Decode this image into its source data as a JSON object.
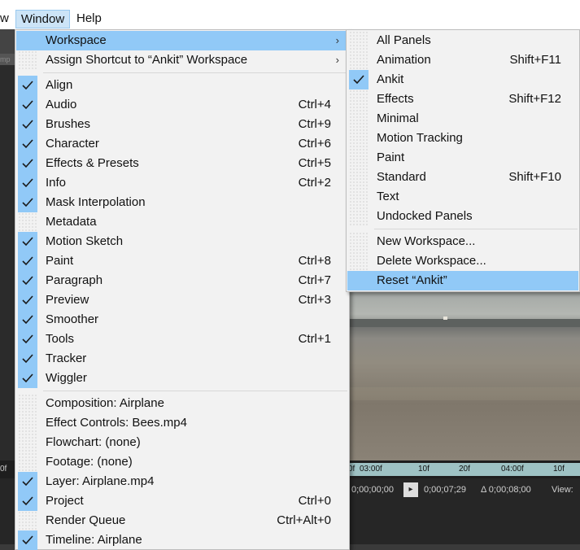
{
  "menubar": {
    "partial_item": "w",
    "window_label": "Window",
    "help_label": "Help"
  },
  "background": {
    "left_fragment": "mp",
    "timeline_ruler": [
      "0f",
      "03:00f",
      "10f",
      "20f",
      "04:00f",
      "10f"
    ],
    "left_ruler": "0f",
    "timecode_start": "0;00;00;00",
    "timecode_current": "0;00;07;29",
    "timecode_delta": "Δ 0;00;08;00",
    "view_label": "View:"
  },
  "window_menu": {
    "items_top": [
      {
        "label": "Workspace",
        "submenu": true,
        "highlight": true
      },
      {
        "label": "Assign Shortcut to “Ankit” Workspace",
        "submenu": true
      }
    ],
    "panels": [
      {
        "label": "Align",
        "checked": true,
        "shortcut": ""
      },
      {
        "label": "Audio",
        "checked": true,
        "shortcut": "Ctrl+4"
      },
      {
        "label": "Brushes",
        "checked": true,
        "shortcut": "Ctrl+9"
      },
      {
        "label": "Character",
        "checked": true,
        "shortcut": "Ctrl+6"
      },
      {
        "label": "Effects & Presets",
        "checked": true,
        "shortcut": "Ctrl+5"
      },
      {
        "label": "Info",
        "checked": true,
        "shortcut": "Ctrl+2"
      },
      {
        "label": "Mask Interpolation",
        "checked": true,
        "shortcut": ""
      },
      {
        "label": "Metadata",
        "checked": false,
        "shortcut": ""
      },
      {
        "label": "Motion Sketch",
        "checked": true,
        "shortcut": ""
      },
      {
        "label": "Paint",
        "checked": true,
        "shortcut": "Ctrl+8"
      },
      {
        "label": "Paragraph",
        "checked": true,
        "shortcut": "Ctrl+7"
      },
      {
        "label": "Preview",
        "checked": true,
        "shortcut": "Ctrl+3"
      },
      {
        "label": "Smoother",
        "checked": true,
        "shortcut": ""
      },
      {
        "label": "Tools",
        "checked": true,
        "shortcut": "Ctrl+1"
      },
      {
        "label": "Tracker",
        "checked": true,
        "shortcut": ""
      },
      {
        "label": "Wiggler",
        "checked": true,
        "shortcut": ""
      }
    ],
    "viewers": [
      {
        "label": "Composition: Airplane",
        "checked": false,
        "shortcut": ""
      },
      {
        "label": "Effect Controls: Bees.mp4",
        "checked": false,
        "shortcut": ""
      },
      {
        "label": "Flowchart: (none)",
        "checked": false,
        "shortcut": ""
      },
      {
        "label": "Footage: (none)",
        "checked": false,
        "shortcut": ""
      },
      {
        "label": "Layer: Airplane.mp4",
        "checked": true,
        "shortcut": ""
      },
      {
        "label": "Project",
        "checked": true,
        "shortcut": "Ctrl+0"
      },
      {
        "label": "Render Queue",
        "checked": false,
        "shortcut": "Ctrl+Alt+0"
      },
      {
        "label": "Timeline: Airplane",
        "checked": true,
        "shortcut": ""
      }
    ]
  },
  "workspace_submenu": {
    "workspaces": [
      {
        "label": "All Panels",
        "checked": false,
        "shortcut": ""
      },
      {
        "label": "Animation",
        "checked": false,
        "shortcut": "Shift+F11"
      },
      {
        "label": "Ankit",
        "checked": true,
        "shortcut": ""
      },
      {
        "label": "Effects",
        "checked": false,
        "shortcut": "Shift+F12"
      },
      {
        "label": "Minimal",
        "checked": false,
        "shortcut": ""
      },
      {
        "label": "Motion Tracking",
        "checked": false,
        "shortcut": ""
      },
      {
        "label": "Paint",
        "checked": false,
        "shortcut": ""
      },
      {
        "label": "Standard",
        "checked": false,
        "shortcut": "Shift+F10"
      },
      {
        "label": "Text",
        "checked": false,
        "shortcut": ""
      },
      {
        "label": "Undocked Panels",
        "checked": false,
        "shortcut": ""
      }
    ],
    "actions": [
      {
        "label": "New Workspace...",
        "highlight": false
      },
      {
        "label": "Delete Workspace...",
        "highlight": false
      },
      {
        "label": "Reset “Ankit”",
        "highlight": true
      }
    ]
  },
  "colors": {
    "highlight": "#91c9f7",
    "menu_bg": "#f2f2f2",
    "menubar_active": "#cce4f7"
  },
  "icons": {
    "check": "checkmark-icon",
    "submenu_arrow": "chevron-right-icon"
  }
}
